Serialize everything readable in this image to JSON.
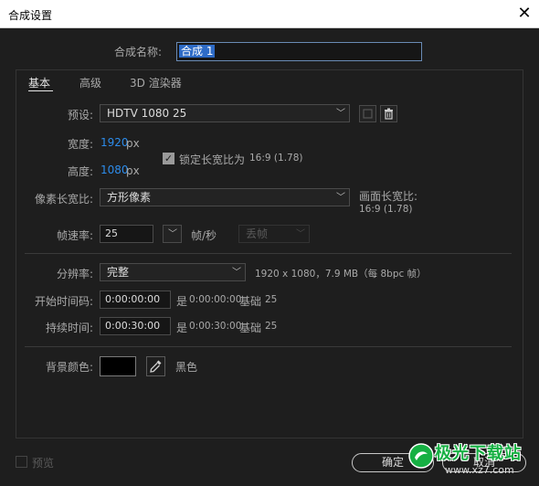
{
  "window": {
    "title": "合成设置",
    "close_glyph": "✕"
  },
  "comp_name": {
    "label": "合成名称:",
    "value": "合成 1"
  },
  "tabs": [
    {
      "label": "基本"
    },
    {
      "label": "高级"
    },
    {
      "label": "3D 渲染器"
    }
  ],
  "preset": {
    "label": "预设:",
    "value": "HDTV 1080 25"
  },
  "width": {
    "label": "宽度:",
    "value": "1920",
    "unit": "px"
  },
  "height": {
    "label": "高度:",
    "value": "1080",
    "unit": "px"
  },
  "lock_aspect": {
    "label": "锁定长宽比为",
    "ratio": "16:9 (1.78)",
    "checked": true
  },
  "pixel_aspect": {
    "label": "像素长宽比:",
    "value": "方形像素"
  },
  "frame_aspect": {
    "label": "画面长宽比:",
    "value": "16:9 (1.78)"
  },
  "frame_rate": {
    "label": "帧速率:",
    "value": "25",
    "unit": "帧/秒",
    "drop_frame": "丢帧"
  },
  "resolution": {
    "label": "分辨率:",
    "value": "完整",
    "info": "1920 x 1080，7.9 MB（每 8bpc 帧）"
  },
  "start_timecode": {
    "label": "开始时间码:",
    "value": "0:00:00:00",
    "note_prefix": "是",
    "note_value": "0:00:00:00",
    "base_label": "基础",
    "base_value": "25"
  },
  "duration": {
    "label": "持续时间:",
    "value": "0:00:30:00",
    "note_prefix": "是",
    "note_value": "0:00:30:00",
    "base_label": "基础",
    "base_value": "25"
  },
  "background": {
    "label": "背景颜色:",
    "color_name": "黑色",
    "color": "#000000"
  },
  "footer": {
    "preview_label": "预览",
    "ok_label": "确定",
    "cancel_label": "取消"
  },
  "watermark": {
    "text": "极光下载站",
    "url": "www.xz7.com"
  },
  "colors": {
    "accent_blue": "#2d8ceb",
    "selection": "#2e6bc6",
    "watermark_green": "#16b043"
  }
}
